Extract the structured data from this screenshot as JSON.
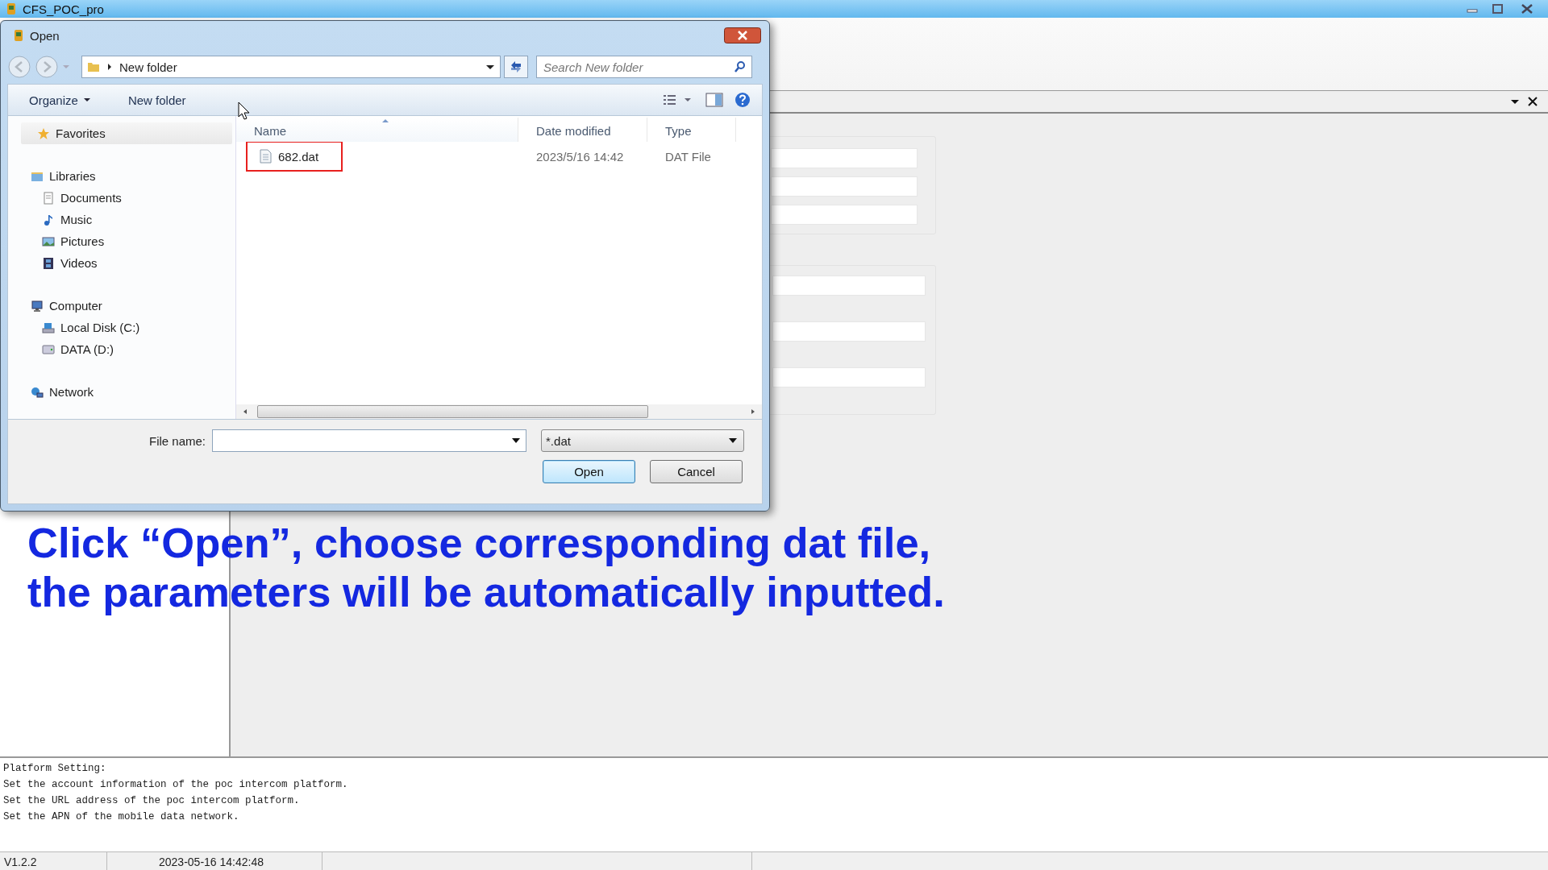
{
  "app_window": {
    "title": "CFS_POC_pro"
  },
  "dialog": {
    "title": "Open",
    "address": {
      "path": "New folder"
    },
    "search": {
      "placeholder": "Search New folder"
    },
    "toolbar": [
      {
        "label": "Organize",
        "kind": "menu"
      },
      {
        "label": "New folder",
        "kind": "button"
      }
    ],
    "nav": [
      {
        "label": "Favorites",
        "header": true
      },
      {
        "label": "Libraries",
        "children": [
          {
            "label": "Documents"
          },
          {
            "label": "Music"
          },
          {
            "label": "Pictures"
          },
          {
            "label": "Videos"
          }
        ]
      },
      {
        "label": "Computer",
        "children": [
          {
            "label": "Local Disk (C:)"
          },
          {
            "label": "DATA (D:)"
          }
        ]
      },
      {
        "label": "Network"
      }
    ],
    "columns": [
      {
        "label": "Name",
        "sorted": true
      },
      {
        "label": "Date modified",
        "sorted": false
      },
      {
        "label": "Type",
        "sorted": false
      }
    ],
    "files": [
      {
        "name": "682.dat",
        "date": "2023/5/16 14:42",
        "type": "DAT File",
        "highlighted": true
      }
    ],
    "file_name": {
      "label": "File name:"
    },
    "filter": {
      "value": "*.dat"
    },
    "buttons": [
      {
        "label": "Open",
        "default": true
      },
      {
        "label": "Cancel",
        "default": false
      }
    ]
  },
  "caption": [
    "Click “Open”, choose corresponding dat file,",
    "the parameters will be automatically inputted."
  ],
  "log": {
    "lines": [
      "Platform Setting:",
      "Set the account information of the poc intercom platform.",
      "Set the URL address of the poc intercom platform.",
      "Set the APN of the mobile data network."
    ]
  },
  "status_bar": [
    "V1.2.2",
    "2023-05-16 14:42:48"
  ]
}
